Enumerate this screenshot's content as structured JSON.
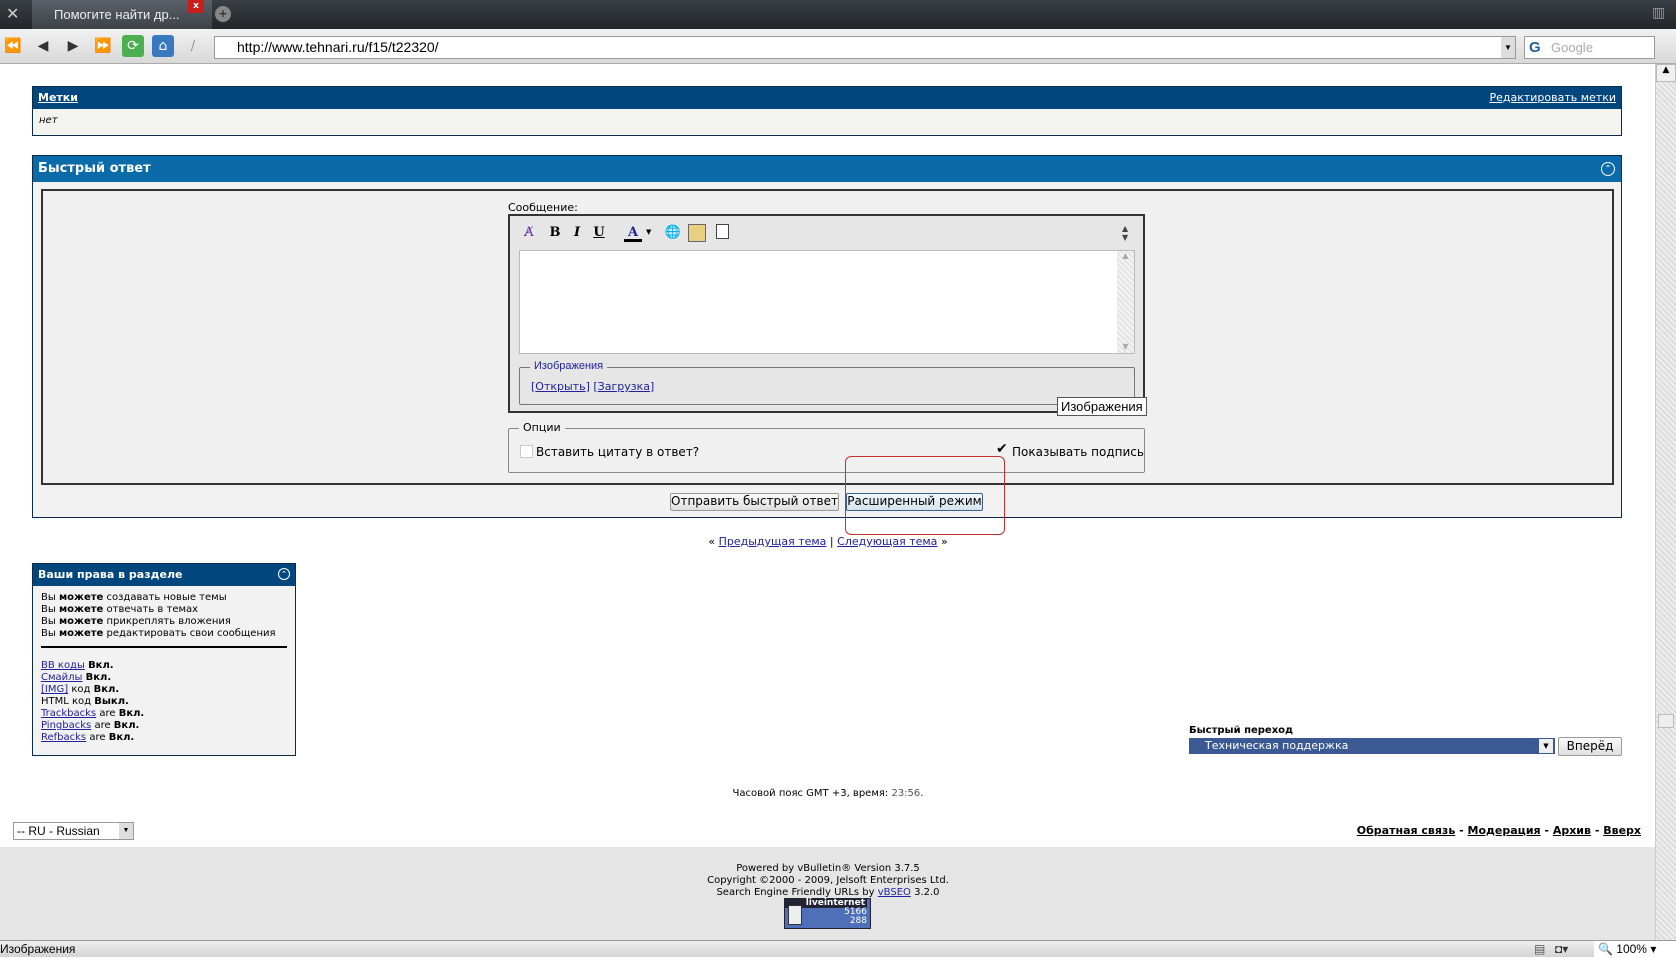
{
  "browser": {
    "tab_title": "Помогите найти др...",
    "tab_close": "x",
    "url": "http://www.tehnari.ru/f15/t22320/",
    "search_placeholder": "Google",
    "zoom": "100%",
    "status_text": "Изображения"
  },
  "tags": {
    "title": "Метки",
    "edit_link": "Редактировать метки",
    "value": "нет"
  },
  "quick_reply": {
    "title": "Быстрый ответ",
    "message_label": "Сообщение:",
    "toolbar": {
      "bold": "B",
      "italic": "I",
      "underline": "U",
      "color": "A"
    },
    "images_legend": "Изображения",
    "open_link": "Открыть",
    "upload_link": "Загрузка",
    "tooltip": "Изображения",
    "options_legend": "Опции",
    "quote_label": "Вставить цитату в ответ?",
    "quote_checked": false,
    "signature_label": "Показывать подпись",
    "signature_checked": true,
    "send_button": "Отправить быстрый ответ",
    "advanced_button": "Расширенный режим"
  },
  "thread_nav": {
    "prev": "Предыдущая тема",
    "sep": "|",
    "next": "Следующая тема",
    "prev_arrows": "«",
    "next_arrows": "»"
  },
  "rights": {
    "title": "Ваши права в разделе",
    "lines": [
      {
        "a": "Вы",
        "b": "можете",
        "c": "создавать новые темы"
      },
      {
        "a": "Вы",
        "b": "можете",
        "c": "отвечать в темах"
      },
      {
        "a": "Вы",
        "b": "можете",
        "c": "прикреплять вложения"
      },
      {
        "a": "Вы",
        "b": "можете",
        "c": "редактировать свои сообщения"
      }
    ],
    "settings": [
      {
        "link": "BB коды",
        "mid": "",
        "val": "Вкл."
      },
      {
        "link": "Смайлы",
        "mid": "",
        "val": "Вкл."
      },
      {
        "link": "[IMG]",
        "mid": "код",
        "val": "Вкл."
      },
      {
        "link": "",
        "mid": "HTML код",
        "val": "Выкл."
      },
      {
        "link": "Trackbacks",
        "mid": "are",
        "val": "Вкл."
      },
      {
        "link": "Pingbacks",
        "mid": "are",
        "val": "Вкл."
      },
      {
        "link": "Refbacks",
        "mid": "are",
        "val": "Вкл."
      }
    ]
  },
  "quick_nav": {
    "label": "Быстрый переход",
    "selected": "Техническая поддержка",
    "go": "Вперёд"
  },
  "time": {
    "prefix": "Часовой пояс GMT +3, время:",
    "value": "23:56",
    "suffix": "."
  },
  "language": "-- RU - Russian",
  "footer_links": [
    "Обратная связь",
    "Модерация",
    "Архив",
    "Вверх"
  ],
  "footer": {
    "line1": "Powered by vBulletin® Version 3.7.5",
    "line2": "Copyright ©2000 - 2009, Jelsoft Enterprises Ltd.",
    "line3_prefix": "Search Engine Friendly URLs by",
    "line3_link": "vBSEO",
    "line3_suffix": "3.2.0",
    "counter": {
      "title": "liveinternet",
      "n1": "5166",
      "n2": "288"
    }
  },
  "colors": {
    "header_dark": "#02467e",
    "header_blue": "#0b6aa8",
    "highlight": "#c43030"
  }
}
